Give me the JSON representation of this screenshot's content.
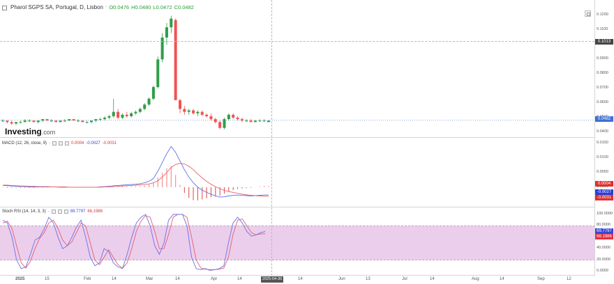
{
  "header": {
    "symbol_title": "Pharol SGPS SA, Portugal, D, Lisbon",
    "separator": "-",
    "open": "O0.0476",
    "high": "H0.0480",
    "low": "L0.0472",
    "close": "C0.0482"
  },
  "logo": {
    "name": "Investing",
    "suffix": ".com"
  },
  "price_axis": {
    "ticks": [
      "0.1200",
      "0.1100",
      "0.1000",
      "0.0900",
      "0.0800",
      "0.0700",
      "0.0600",
      "0.0500",
      "0.0400"
    ],
    "marker_label": "0.1013",
    "last_price_label": "0.0482"
  },
  "macd": {
    "title": "MACD (12, 26, close, 9)",
    "separator": "-",
    "value_hist": "0.0004",
    "value_macd": "-0.0027",
    "value_signal": "-0.0031",
    "ticks": [
      "0.0150",
      "0.0100",
      "0.0050",
      "0.0000"
    ],
    "tag_hist": "0.0004",
    "tag_macd": "-0.0027",
    "tag_signal": "-0.0031"
  },
  "stoch_rsi": {
    "title": "Stoch RSI (14, 14, 3, 3)",
    "separator": "-",
    "value_k": "69.7797",
    "value_d": "66.1986",
    "ticks": [
      "100.0000",
      "80.0000",
      "60.0000",
      "40.0000",
      "20.0000",
      "0.0000"
    ],
    "tag_k": "69.7797",
    "tag_d": "66.1986"
  },
  "time_axis": {
    "labels": [
      "2025",
      "15",
      "Feb",
      "14",
      "Mar",
      "14",
      "Apr",
      "14",
      "14",
      "Jun",
      "13",
      "Jul",
      "14",
      "Aug",
      "14",
      "Sep",
      "12"
    ],
    "cursor_date": "2025-04-30"
  },
  "colors": {
    "up": "#26a69a",
    "up_body": "#2e9e48",
    "down": "#ef5350",
    "macd_line": "#5b6fe8",
    "signal_line": "#e8606a",
    "stoch_k": "#6b6fe8",
    "stoch_d": "#e35d75",
    "band_fill": "#e8c6e8",
    "last_price_tag": "#3d6fd4",
    "marker_tag": "#444444",
    "hist_tag": "#e03030",
    "macd_tag": "#2a3fd6",
    "signal_tag": "#e03030",
    "k_tag": "#3a45d8",
    "d_tag": "#e03040"
  },
  "chart_data": [
    {
      "type": "candlestick",
      "title": "Pharol SGPS SA, Portugal, D, Lisbon",
      "ylim": [
        0.04,
        0.125
      ],
      "candles": [
        [
          0.048,
          0.049,
          0.047,
          0.048
        ],
        [
          0.048,
          0.048,
          0.046,
          0.047
        ],
        [
          0.047,
          0.048,
          0.045,
          0.046
        ],
        [
          0.046,
          0.047,
          0.045,
          0.047
        ],
        [
          0.047,
          0.048,
          0.046,
          0.047
        ],
        [
          0.047,
          0.049,
          0.047,
          0.048
        ],
        [
          0.048,
          0.049,
          0.047,
          0.048
        ],
        [
          0.048,
          0.048,
          0.047,
          0.047
        ],
        [
          0.047,
          0.048,
          0.046,
          0.048
        ],
        [
          0.048,
          0.049,
          0.047,
          0.049
        ],
        [
          0.049,
          0.049,
          0.048,
          0.048
        ],
        [
          0.048,
          0.049,
          0.047,
          0.048
        ],
        [
          0.048,
          0.048,
          0.047,
          0.047
        ],
        [
          0.047,
          0.048,
          0.047,
          0.048
        ],
        [
          0.048,
          0.049,
          0.047,
          0.048
        ],
        [
          0.048,
          0.049,
          0.048,
          0.049
        ],
        [
          0.049,
          0.049,
          0.048,
          0.048
        ],
        [
          0.048,
          0.049,
          0.047,
          0.048
        ],
        [
          0.048,
          0.048,
          0.047,
          0.047
        ],
        [
          0.047,
          0.048,
          0.046,
          0.047
        ],
        [
          0.047,
          0.048,
          0.046,
          0.048
        ],
        [
          0.048,
          0.049,
          0.047,
          0.049
        ],
        [
          0.049,
          0.05,
          0.048,
          0.049
        ],
        [
          0.049,
          0.051,
          0.048,
          0.05
        ],
        [
          0.05,
          0.052,
          0.049,
          0.051
        ],
        [
          0.051,
          0.063,
          0.05,
          0.054
        ],
        [
          0.054,
          0.056,
          0.049,
          0.05
        ],
        [
          0.05,
          0.053,
          0.049,
          0.052
        ],
        [
          0.052,
          0.054,
          0.05,
          0.051
        ],
        [
          0.051,
          0.054,
          0.05,
          0.053
        ],
        [
          0.053,
          0.055,
          0.052,
          0.054
        ],
        [
          0.054,
          0.057,
          0.053,
          0.056
        ],
        [
          0.056,
          0.06,
          0.055,
          0.059
        ],
        [
          0.059,
          0.064,
          0.058,
          0.063
        ],
        [
          0.063,
          0.072,
          0.062,
          0.071
        ],
        [
          0.071,
          0.092,
          0.07,
          0.09
        ],
        [
          0.09,
          0.108,
          0.088,
          0.105
        ],
        [
          0.105,
          0.115,
          0.1,
          0.112
        ],
        [
          0.112,
          0.12,
          0.108,
          0.118
        ],
        [
          0.117,
          0.118,
          0.062,
          0.062
        ],
        [
          0.062,
          0.063,
          0.053,
          0.056
        ],
        [
          0.056,
          0.058,
          0.052,
          0.054
        ],
        [
          0.054,
          0.056,
          0.052,
          0.055
        ],
        [
          0.055,
          0.056,
          0.052,
          0.053
        ],
        [
          0.053,
          0.055,
          0.051,
          0.054
        ],
        [
          0.054,
          0.055,
          0.051,
          0.052
        ],
        [
          0.052,
          0.053,
          0.05,
          0.051
        ],
        [
          0.051,
          0.053,
          0.048,
          0.049
        ],
        [
          0.049,
          0.05,
          0.046,
          0.047
        ],
        [
          0.047,
          0.048,
          0.042,
          0.043
        ],
        [
          0.043,
          0.05,
          0.042,
          0.049
        ],
        [
          0.049,
          0.053,
          0.048,
          0.052
        ],
        [
          0.052,
          0.053,
          0.049,
          0.05
        ],
        [
          0.05,
          0.051,
          0.048,
          0.049
        ],
        [
          0.049,
          0.05,
          0.047,
          0.048
        ],
        [
          0.048,
          0.049,
          0.047,
          0.048
        ],
        [
          0.048,
          0.049,
          0.047,
          0.047
        ],
        [
          0.047,
          0.048,
          0.047,
          0.048
        ],
        [
          0.048,
          0.049,
          0.047,
          0.048
        ],
        [
          0.048,
          0.049,
          0.047,
          0.048
        ],
        [
          0.047,
          0.048,
          0.047,
          0.048
        ]
      ]
    },
    {
      "type": "line",
      "title": "MACD (12, 26, close, 9)",
      "ylim": [
        -0.006,
        0.016
      ],
      "series": [
        {
          "name": "MACD",
          "values": [
            0.0006,
            0.0005,
            0.0004,
            0.0003,
            0.0002,
            0.0002,
            0.0001,
            0.0001,
            0.0001,
            0.0001,
            0.0001,
            0.0001,
            0.0001,
            0.0,
            0.0,
            0.0,
            0.0,
            0.0,
            0.0,
            0.0,
            0.0,
            0.0,
            0.0001,
            0.0002,
            0.0003,
            0.0005,
            0.0006,
            0.0007,
            0.0008,
            0.0009,
            0.001,
            0.0012,
            0.0015,
            0.002,
            0.003,
            0.0055,
            0.0085,
            0.0115,
            0.014,
            0.012,
            0.009,
            0.006,
            0.0035,
            0.0015,
            0.0,
            -0.001,
            -0.0018,
            -0.0024,
            -0.003,
            -0.0034,
            -0.0033,
            -0.003,
            -0.0028,
            -0.0027,
            -0.0028,
            -0.0029,
            -0.003,
            -0.0029,
            -0.0028,
            -0.0027,
            -0.0027
          ]
        },
        {
          "name": "Signal",
          "values": [
            0.0007,
            0.0007,
            0.0006,
            0.0005,
            0.0004,
            0.0004,
            0.0003,
            0.0003,
            0.0002,
            0.0002,
            0.0002,
            0.0001,
            0.0001,
            0.0001,
            0.0001,
            0.0,
            0.0,
            0.0,
            0.0,
            0.0,
            0.0,
            0.0,
            0.0,
            0.0001,
            0.0001,
            0.0002,
            0.0003,
            0.0004,
            0.0005,
            0.0006,
            0.0007,
            0.0008,
            0.0009,
            0.0011,
            0.0015,
            0.0022,
            0.0035,
            0.005,
            0.0068,
            0.0078,
            0.0082,
            0.008,
            0.0072,
            0.006,
            0.0045,
            0.0032,
            0.002,
            0.001,
            0.0002,
            -0.0005,
            -0.0011,
            -0.0015,
            -0.0018,
            -0.0021,
            -0.0024,
            -0.0026,
            -0.0028,
            -0.0029,
            -0.003,
            -0.0031,
            -0.0031
          ]
        }
      ]
    },
    {
      "type": "line",
      "title": "Stoch RSI (14, 14, 3, 3)",
      "ylim": [
        0,
        100
      ],
      "series": [
        {
          "name": "K",
          "values": [
            90,
            85,
            60,
            20,
            5,
            8,
            30,
            55,
            60,
            75,
            95,
            85,
            60,
            40,
            45,
            60,
            78,
            90,
            60,
            25,
            10,
            15,
            40,
            35,
            15,
            8,
            5,
            30,
            60,
            85,
            95,
            100,
            80,
            45,
            30,
            50,
            90,
            100,
            100,
            100,
            80,
            25,
            5,
            3,
            5,
            2,
            3,
            5,
            10,
            50,
            85,
            95,
            85,
            70,
            62,
            64,
            68,
            70
          ]
        },
        {
          "name": "D",
          "values": [
            85,
            88,
            75,
            45,
            15,
            6,
            18,
            40,
            58,
            68,
            85,
            90,
            75,
            55,
            45,
            52,
            68,
            85,
            80,
            50,
            20,
            12,
            25,
            38,
            25,
            12,
            6,
            15,
            40,
            70,
            88,
            98,
            95,
            70,
            40,
            40,
            65,
            95,
            100,
            100,
            95,
            60,
            20,
            6,
            4,
            3,
            3,
            4,
            6,
            25,
            65,
            90,
            92,
            80,
            68,
            64,
            66,
            66
          ]
        }
      ]
    }
  ]
}
